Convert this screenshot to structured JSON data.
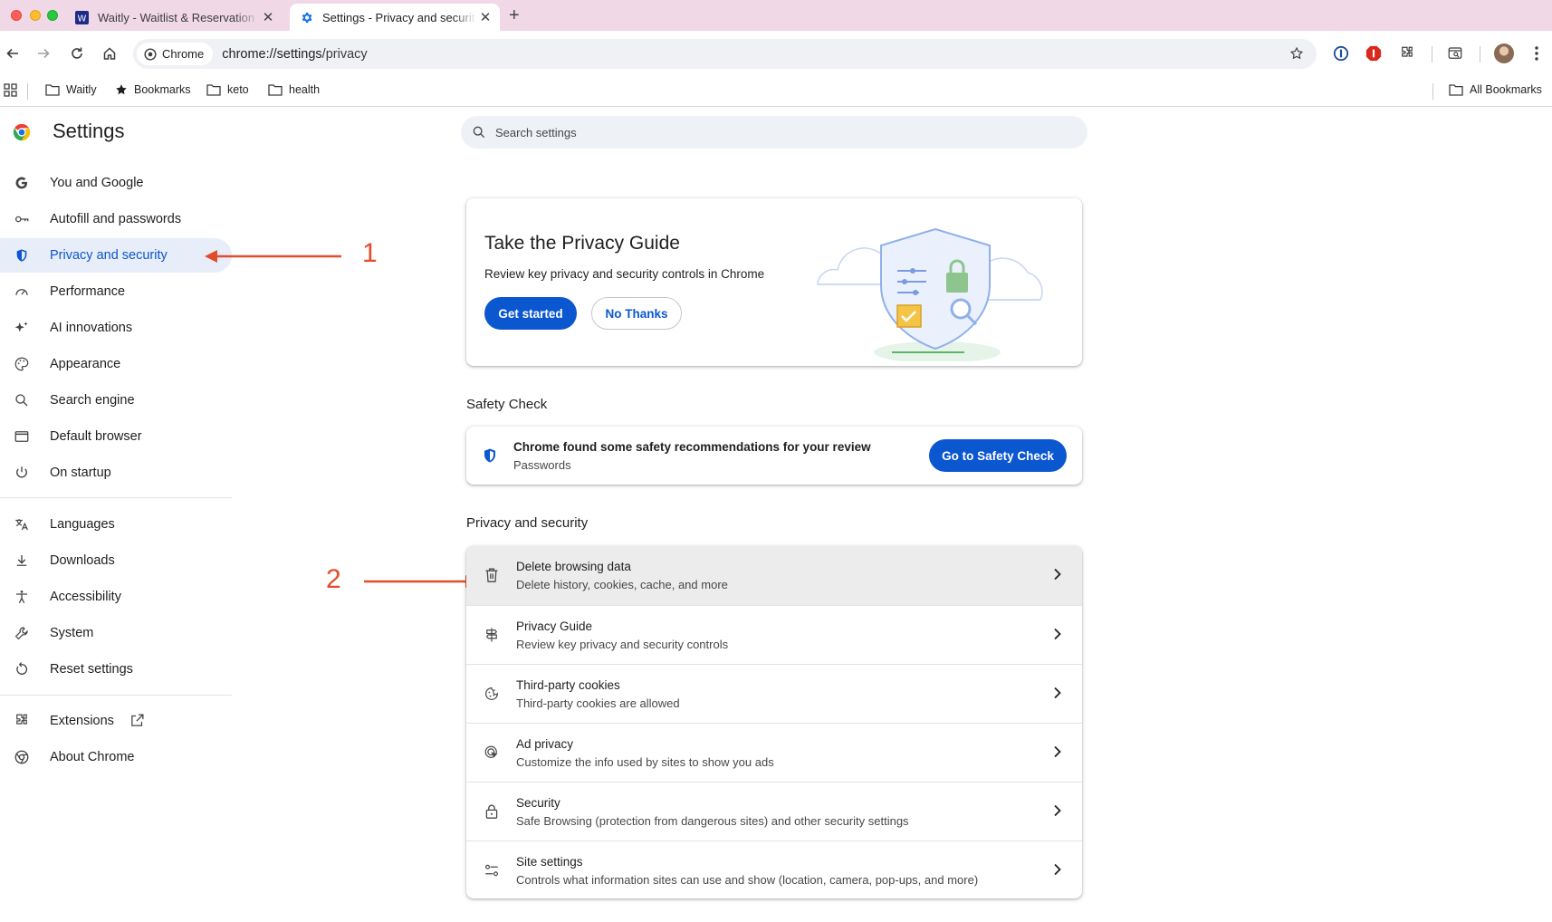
{
  "tabs": [
    {
      "title": "Waitly - Waitlist & Reservation",
      "icon": "waitly-favicon",
      "active": false
    },
    {
      "title": "Settings - Privacy and security",
      "icon": "settings-gear-icon",
      "active": true
    }
  ],
  "toolbar": {
    "chip_label": "Chrome",
    "url_host": "chrome://settings",
    "url_path": "/privacy"
  },
  "bookmarks": {
    "items": [
      {
        "label": "Waitly",
        "icon": "folder-icon"
      },
      {
        "label": "Bookmarks",
        "icon": "star-icon"
      },
      {
        "label": "keto",
        "icon": "folder-icon"
      },
      {
        "label": "health",
        "icon": "folder-icon"
      }
    ],
    "all_bookmarks": "All Bookmarks"
  },
  "sidebar": {
    "title": "Settings",
    "items": [
      {
        "label": "You and Google",
        "icon": "google-g-icon"
      },
      {
        "label": "Autofill and passwords",
        "icon": "key-icon"
      },
      {
        "label": "Privacy and security",
        "icon": "shield-icon",
        "active": true
      },
      {
        "label": "Performance",
        "icon": "speedometer-icon"
      },
      {
        "label": "AI innovations",
        "icon": "sparkle-icon"
      },
      {
        "label": "Appearance",
        "icon": "palette-icon"
      },
      {
        "label": "Search engine",
        "icon": "search-icon"
      },
      {
        "label": "Default browser",
        "icon": "browser-window-icon"
      },
      {
        "label": "On startup",
        "icon": "power-icon"
      },
      {
        "label": "Languages",
        "icon": "translate-icon"
      },
      {
        "label": "Downloads",
        "icon": "download-icon"
      },
      {
        "label": "Accessibility",
        "icon": "accessibility-icon"
      },
      {
        "label": "System",
        "icon": "wrench-icon"
      },
      {
        "label": "Reset settings",
        "icon": "reset-icon"
      },
      {
        "label": "Extensions",
        "icon": "puzzle-icon"
      },
      {
        "label": "About Chrome",
        "icon": "chrome-icon"
      }
    ]
  },
  "annotations": {
    "one": "1",
    "two": "2",
    "color": "#e24c2a"
  },
  "search": {
    "placeholder": "Search settings"
  },
  "privacy_guide": {
    "title": "Take the Privacy Guide",
    "subtitle": "Review key privacy and security controls in Chrome",
    "primary_button": "Get started",
    "secondary_button": "No Thanks"
  },
  "safety_check": {
    "heading": "Safety Check",
    "title": "Chrome found some safety recommendations for your review",
    "subtitle": "Passwords",
    "button": "Go to Safety Check"
  },
  "privacy_section": {
    "heading": "Privacy and security",
    "rows": [
      {
        "title": "Delete browsing data",
        "subtitle": "Delete history, cookies, cache, and more",
        "icon": "trash-icon"
      },
      {
        "title": "Privacy Guide",
        "subtitle": "Review key privacy and security controls",
        "icon": "signpost-icon"
      },
      {
        "title": "Third-party cookies",
        "subtitle": "Third-party cookies are allowed",
        "icon": "cookie-icon"
      },
      {
        "title": "Ad privacy",
        "subtitle": "Customize the info used by sites to show you ads",
        "icon": "ad-privacy-icon"
      },
      {
        "title": "Security",
        "subtitle": "Safe Browsing (protection from dangerous sites) and other security settings",
        "icon": "lock-icon"
      },
      {
        "title": "Site settings",
        "subtitle": "Controls what information sites can use and show (location, camera, pop-ups, and more)",
        "icon": "sliders-icon"
      }
    ]
  },
  "colors": {
    "accent": "#0b57d0",
    "active_bg": "#e8edfa",
    "tabstrip": "#f0d8e6"
  }
}
